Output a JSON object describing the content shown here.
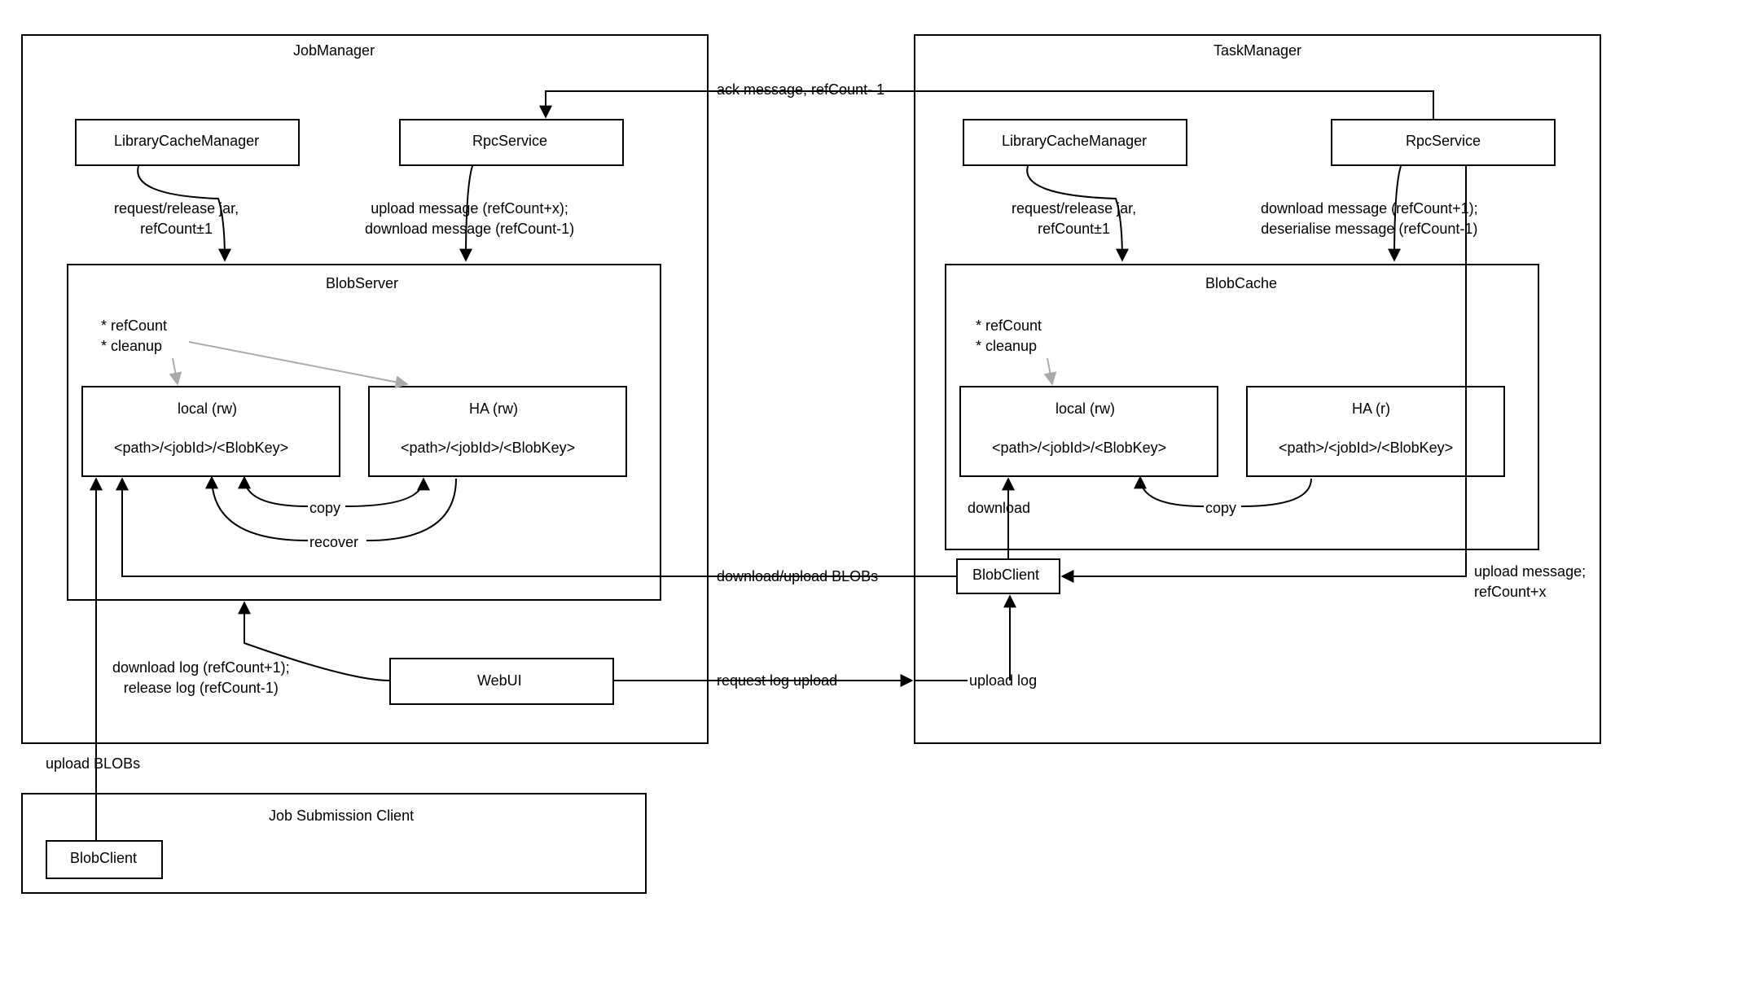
{
  "jobManager": {
    "title": "JobManager",
    "libCache": "LibraryCacheManager",
    "rpc": "RpcService",
    "libCacheEdge": "request/release jar,\nrefCount±1",
    "rpcEdge": "upload message (refCount+x);\ndownload message (refCount-1)",
    "blobServer": {
      "title": "BlobServer",
      "notes": "* refCount\n* cleanup",
      "local": {
        "title": "local (rw)",
        "path": "<path>/<jobId>/<BlobKey>"
      },
      "ha": {
        "title": "HA (rw)",
        "path": "<path>/<jobId>/<BlobKey>"
      },
      "copy": "copy",
      "recover": "recover"
    },
    "webui": "WebUI",
    "webuiEdge": "download log (refCount+1);\nrelease log (refCount-1)"
  },
  "taskManager": {
    "title": "TaskManager",
    "libCache": "LibraryCacheManager",
    "rpc": "RpcService",
    "libCacheEdge": "request/release jar,\nrefCount±1",
    "rpcEdge": "download message (refCount+1);\ndeserialise message (refCount-1)",
    "blobCache": {
      "title": "BlobCache",
      "notes": "* refCount\n* cleanup",
      "local": {
        "title": "local (rw)",
        "path": "<path>/<jobId>/<BlobKey>"
      },
      "ha": {
        "title": "HA (r)",
        "path": "<path>/<jobId>/<BlobKey>"
      },
      "copy": "copy",
      "download": "download"
    },
    "blobClient": "BlobClient",
    "rpcBlobClientEdge": "upload message;\nrefCount+x",
    "uploadLog": "upload log"
  },
  "crossEdges": {
    "ack": "ack message, refCount- 1",
    "downloadUpload": "download/upload BLOBs",
    "requestLog": "request log upload"
  },
  "client": {
    "title": "Job Submission Client",
    "blobClient": "BlobClient",
    "uploadBlobs": "upload BLOBs"
  }
}
